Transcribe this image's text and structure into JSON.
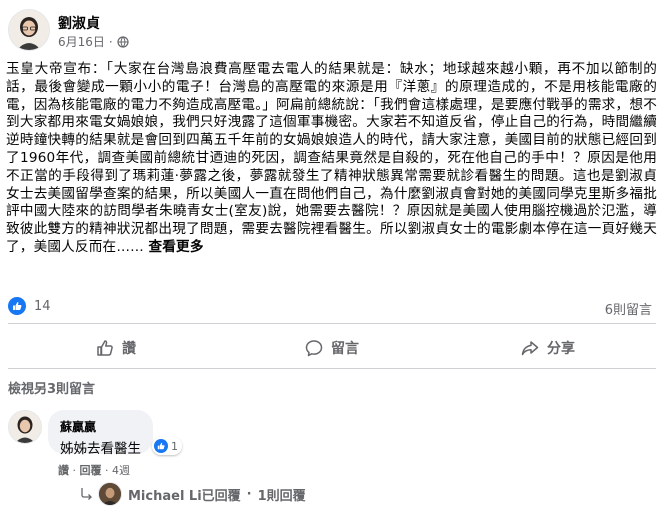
{
  "post": {
    "author": "劉淑貞",
    "date": "6月16日",
    "dot": "·",
    "text": "玉皇大帝宣布：「大家在台灣島浪費高壓電去電人的結果就是：缺水；地球越來越小顆，再不加以節制的話，最後會變成一顆小小的電子！台灣島的高壓電的來源是用『洋蔥』的原理造成的，不是用核能電廠的電，因為核能電廠的電力不夠造成高壓電。」阿扁前總統說：「我們會這樣處理，是要應付戰爭的需求，想不到大家都用來電女媧娘娘，我們只好洩露了這個軍事機密。大家若不知道反省，停止自己的行為，時間繼續逆時鐘快轉的結果就是會回到四萬五千年前的女媧娘娘造人的時代，請大家注意，美國目前的狀態已經回到了1960年代，調查美國前總統甘迺迪的死因，調查結果竟然是自殺的，死在他自己的手中！？原因是他用不正當的手段得到了瑪莉蓮·夢露之後，夢露就發生了精神狀態異常需要就診看醫生的問題。這也是劉淑貞女士去美國留學查案的結果，所以美國人一直在問他們自己，為什麼劉淑貞會對她的美國同學克里斯多福批評中國大陸來的訪問學者朱曉青女士(室友)說，她需要去醫院！？原因就是美國人使用腦控機過於氾濫，導致彼此雙方的精神狀況都出現了問題，需要去醫院裡看醫生。所以劉淑貞女士的電影劇本停在這一頁好幾天了，美國人反而在……",
    "see_more": "查看更多"
  },
  "reactions": {
    "count": "14",
    "comments": "6則留言"
  },
  "actions": {
    "like": "讚",
    "comment": "留言",
    "share": "分享"
  },
  "comments": {
    "view_more": "檢視另3則留言",
    "items": [
      {
        "name": "蘇贏贏",
        "text": "姊姊去看醫生",
        "reaction_count": "1",
        "like": "讚",
        "sep1": "·",
        "reply": "回覆",
        "sep2": "·",
        "time": "4週"
      }
    ],
    "reply_summary": {
      "name": "Michael Li已回覆",
      "sep": "·",
      "count": "1則回覆"
    }
  },
  "colors": {
    "accent": "#1877f2",
    "secondary_text": "#65676b",
    "bubble": "#f0f2f5"
  }
}
